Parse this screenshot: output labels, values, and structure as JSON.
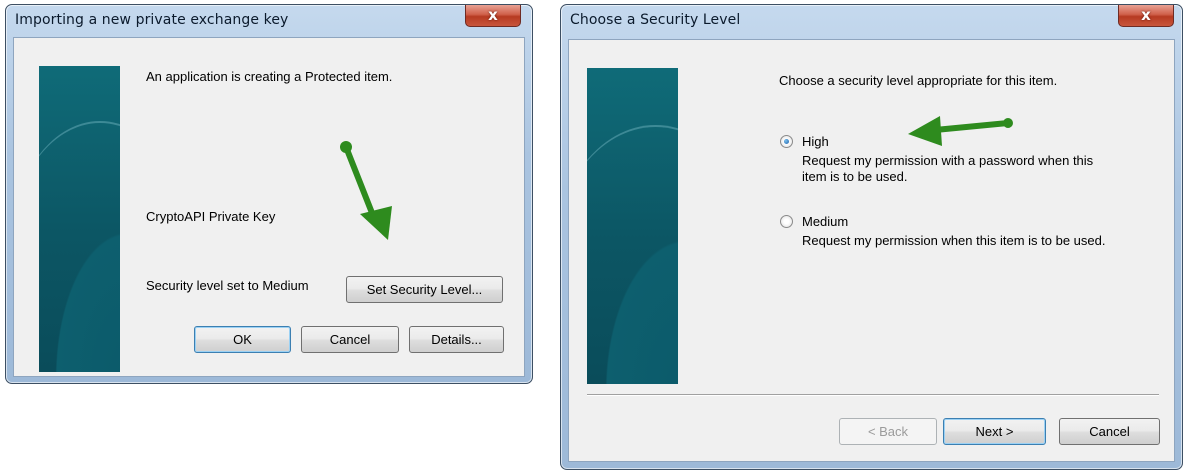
{
  "dialog1": {
    "title": "Importing a new private exchange key",
    "close_label": "x",
    "message": "An application is creating a Protected item.",
    "item_name": "CryptoAPI Private Key",
    "security_status": "Security level set to Medium",
    "set_security_label": "Set Security Level...",
    "ok_label": "OK",
    "cancel_label": "Cancel",
    "details_label": "Details..."
  },
  "dialog2": {
    "title": "Choose a Security Level",
    "close_label": "x",
    "instruction": "Choose a security level appropriate for this item.",
    "options": [
      {
        "label": "High",
        "checked": true,
        "description_line1": "Request my permission with a password when this",
        "description_line2": "item is to be used."
      },
      {
        "label": "Medium",
        "checked": false,
        "description_line1": "Request my permission when this item is to be used.",
        "description_line2": ""
      }
    ],
    "back_label": "< Back",
    "next_label": "Next >",
    "cancel_label": "Cancel"
  },
  "colors": {
    "annotation_arrow": "#2e8b1e",
    "banner": "#0d5f6e",
    "close_button": "#c7452c"
  },
  "icons": [
    "close-icon",
    "annotation-arrow-icon"
  ]
}
